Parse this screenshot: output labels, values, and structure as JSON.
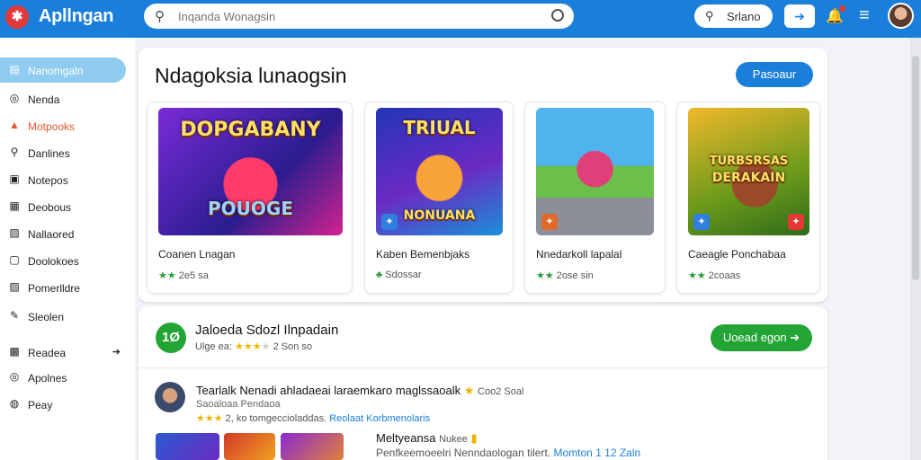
{
  "app": {
    "name": "Apllngan",
    "logo_glyph": "✱"
  },
  "search": {
    "placeholder": "Inqanda Wonagsin"
  },
  "toolbar": {
    "pill_label": "Srlano",
    "arrow_label": "➔"
  },
  "sidebar": {
    "items": [
      {
        "label": "Nanomgaln",
        "icon": "▤",
        "state": "active"
      },
      {
        "label": "Nenda",
        "icon": "◎"
      },
      {
        "label": "Motpooks",
        "icon": "▲",
        "state": "highlight"
      },
      {
        "label": "Danlines",
        "icon": "⚲"
      },
      {
        "label": "Notepos",
        "icon": "▣"
      },
      {
        "label": "Deobous",
        "icon": "▦"
      },
      {
        "label": "Nallaored",
        "icon": "▧"
      },
      {
        "label": "Doolokoes",
        "icon": "▢"
      },
      {
        "label": "Pomerlldre",
        "icon": "▨"
      },
      {
        "label": "Sleolen",
        "icon": "✎"
      },
      {
        "label": "Readea",
        "icon": "▩",
        "chevron": "➔"
      },
      {
        "label": "Apolnes",
        "icon": "◎"
      },
      {
        "label": "Peay",
        "icon": "◍"
      }
    ]
  },
  "featured": {
    "title": "Ndagoksia lunaogsin",
    "button": "Pasoaur",
    "games": [
      {
        "name": "Coanen Lnagan",
        "stars": "★★",
        "rating": "2e5 sa",
        "art_title": "DOPGABANY",
        "art_sub": "POUOGE",
        "art_color": "#5a2bb8"
      },
      {
        "name": "Kaben Bemenbjaks",
        "stars": "♣",
        "rating": "Sdossar",
        "art_title": "TRIUAL",
        "art_sub": "NONUANA",
        "art_color": "#1d3fb0"
      },
      {
        "name": "Nnedarkoll lapalal",
        "stars": "★★",
        "rating": "2ose sin",
        "art_title": "",
        "art_sub": "",
        "art_color": "#2f9be0"
      },
      {
        "name": "Caeagle Ponchabaa",
        "stars": "★★",
        "rating": "2coaas",
        "art_title": "TURBSRSAS",
        "art_sub": "DERAKAIN",
        "art_color": "#6b9a1a"
      }
    ]
  },
  "app_detail": {
    "icon_label": "1Ø",
    "name": "Jaloeda Sdozl Ilnpadain",
    "meta_prefix": "Ulge ea:",
    "stars": "★★★",
    "rating": "2 Son so",
    "button": "Uoead egon ➔",
    "review1": {
      "title": "Tearlalk Nenadi ahladaeai laraemkaro maglssaoalk",
      "title_suffix": "Coo2 Soal",
      "subtitle": "Saoaloaa Pendaoa",
      "stars": "★★★",
      "meta": "2, ko tomgeccioladdas.",
      "link": "Reolaat Korbmenolaris"
    },
    "review2": {
      "title": "Meltyeansa",
      "title_suffix": "Nukee",
      "subtitle": "Penfkeemoeelri Nenndaologan tilert.",
      "link": "Momton 1 12 Zaln"
    }
  },
  "colors": {
    "accent": "#1a7fdb",
    "green": "#22a535",
    "highlight": "#e1552f"
  }
}
